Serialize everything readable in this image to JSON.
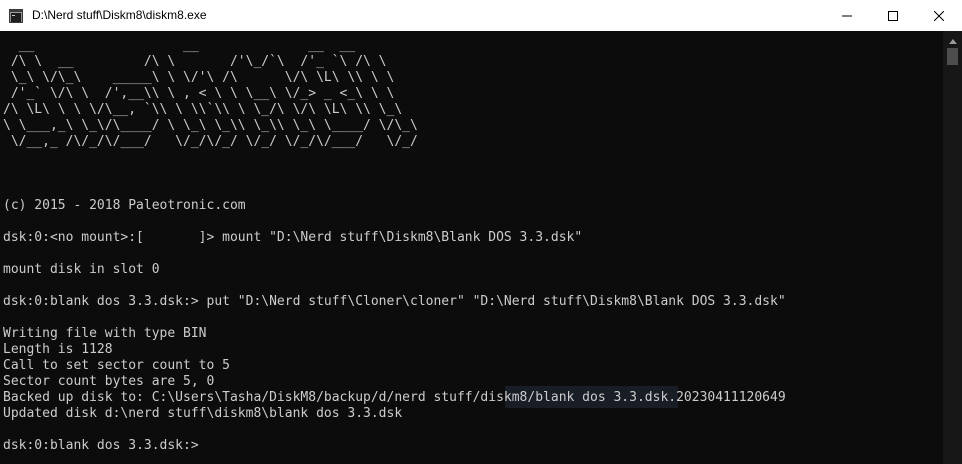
{
  "window": {
    "title": "D:\\Nerd stuff\\Diskm8\\diskm8.exe",
    "colors": {
      "titlebar_bg": "#ffffff",
      "console_bg": "#0c0c0c",
      "console_text": "#cccccc"
    }
  },
  "icons": {
    "app": "console-app-icon",
    "minimize": "minimize-icon",
    "maximize": "maximize-icon",
    "close": "close-icon",
    "scroll_up": "chevron-up-icon"
  },
  "console": {
    "banner": [
      "  __                   __              __  __",
      " /\\ \\  __         /\\ \\       /'\\_/`\\  /'_ `\\ /\\ \\",
      " \\_\\ \\/\\_\\    _____\\ \\ \\/'\\ /\\      \\/\\ \\L\\ \\\\ \\ \\",
      " /'_` \\/\\ \\  /',__\\\\ \\ , < \\ \\ \\__\\ \\/_> _ <_\\ \\ \\",
      "/\\ \\L\\ \\ \\ \\/\\__, `\\\\ \\ \\\\`\\\\ \\ \\_/\\ \\/\\ \\L\\ \\\\ \\_\\",
      "\\ \\___,_\\ \\_\\/\\____/ \\ \\_\\ \\_\\\\ \\_\\\\ \\_\\ \\____/ \\/\\_\\",
      " \\/__,_ /\\/_/\\/___/   \\/_/\\/_/ \\/_/ \\/_/\\/___/   \\/_/"
    ],
    "blank_1": "",
    "blank_2": "",
    "blank_3": "",
    "copyright": "(c) 2015 - 2018 Paleotronic.com",
    "blank_4": "",
    "cmd_mount": "dsk:0:<no mount>:[       ]> mount \"D:\\Nerd stuff\\Diskm8\\Blank DOS 3.3.dsk\"",
    "blank_5": "",
    "mount_result": "mount disk in slot 0",
    "blank_6": "",
    "cmd_put": "dsk:0:blank dos 3.3.dsk:> put \"D:\\Nerd stuff\\Cloner\\cloner\" \"D:\\Nerd stuff\\Diskm8\\Blank DOS 3.3.dsk\"",
    "blank_7": "",
    "out_writing": "Writing file with type BIN",
    "out_length": "Length is 1128",
    "out_call": "Call to set sector count to 5",
    "out_bytes": "Sector count bytes are 5, 0",
    "out_backup": "Backed up disk to: C:\\Users\\Tasha/DiskM8/backup/d/nerd stuff/diskm8/blank dos 3.3.dsk.20230411120649",
    "out_updated": "Updated disk d:\\nerd stuff\\diskm8\\blank dos 3.3.dsk",
    "blank_8": "",
    "prompt": "dsk:0:blank dos 3.3.dsk:>"
  }
}
